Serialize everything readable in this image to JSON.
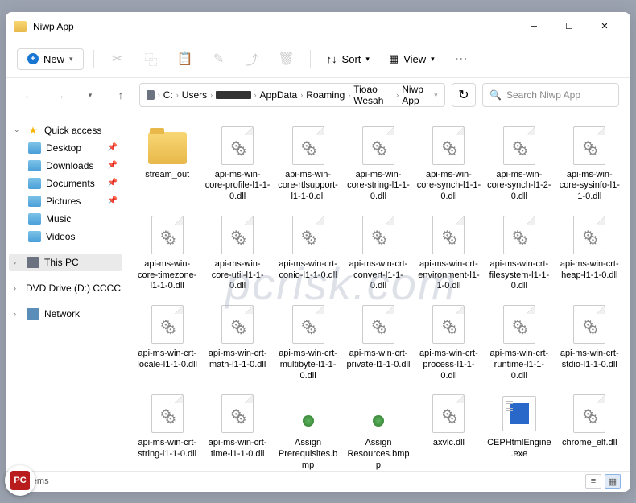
{
  "window": {
    "title": "Niwp App"
  },
  "toolbar": {
    "new_label": "New",
    "sort_label": "Sort",
    "view_label": "View"
  },
  "path": {
    "segments": [
      "C:",
      "Users",
      "[REDACTED]",
      "AppData",
      "Roaming",
      "Tioao Wesah",
      "Niwp App"
    ]
  },
  "search": {
    "placeholder": "Search Niwp App"
  },
  "sidebar": {
    "quick_access": "Quick access",
    "items": [
      {
        "label": "Desktop"
      },
      {
        "label": "Downloads"
      },
      {
        "label": "Documents"
      },
      {
        "label": "Pictures"
      },
      {
        "label": "Music"
      },
      {
        "label": "Videos"
      }
    ],
    "this_pc": "This PC",
    "dvd": "DVD Drive (D:) CCCC",
    "network": "Network"
  },
  "files": [
    {
      "name": "stream_out",
      "type": "folder"
    },
    {
      "name": "api-ms-win-core-profile-l1-1-0.dll",
      "type": "dll"
    },
    {
      "name": "api-ms-win-core-rtlsupport-l1-1-0.dll",
      "type": "dll"
    },
    {
      "name": "api-ms-win-core-string-l1-1-0.dll",
      "type": "dll"
    },
    {
      "name": "api-ms-win-core-synch-l1-1-0.dll",
      "type": "dll"
    },
    {
      "name": "api-ms-win-core-synch-l1-2-0.dll",
      "type": "dll"
    },
    {
      "name": "api-ms-win-core-sysinfo-l1-1-0.dll",
      "type": "dll"
    },
    {
      "name": "api-ms-win-core-timezone-l1-1-0.dll",
      "type": "dll"
    },
    {
      "name": "api-ms-win-core-util-l1-1-0.dll",
      "type": "dll"
    },
    {
      "name": "api-ms-win-crt-conio-l1-1-0.dll",
      "type": "dll"
    },
    {
      "name": "api-ms-win-crt-convert-l1-1-0.dll",
      "type": "dll"
    },
    {
      "name": "api-ms-win-crt-environment-l1-1-0.dll",
      "type": "dll"
    },
    {
      "name": "api-ms-win-crt-filesystem-l1-1-0.dll",
      "type": "dll"
    },
    {
      "name": "api-ms-win-crt-heap-l1-1-0.dll",
      "type": "dll"
    },
    {
      "name": "api-ms-win-crt-locale-l1-1-0.dll",
      "type": "dll"
    },
    {
      "name": "api-ms-win-crt-math-l1-1-0.dll",
      "type": "dll"
    },
    {
      "name": "api-ms-win-crt-multibyte-l1-1-0.dll",
      "type": "dll"
    },
    {
      "name": "api-ms-win-crt-private-l1-1-0.dll",
      "type": "dll"
    },
    {
      "name": "api-ms-win-crt-process-l1-1-0.dll",
      "type": "dll"
    },
    {
      "name": "api-ms-win-crt-runtime-l1-1-0.dll",
      "type": "dll"
    },
    {
      "name": "api-ms-win-crt-stdio-l1-1-0.dll",
      "type": "dll"
    },
    {
      "name": "api-ms-win-crt-string-l1-1-0.dll",
      "type": "dll"
    },
    {
      "name": "api-ms-win-crt-time-l1-1-0.dll",
      "type": "dll"
    },
    {
      "name": "Assign Prerequisites.bmp",
      "type": "bmp"
    },
    {
      "name": "Assign Resources.bmpp",
      "type": "bmp"
    },
    {
      "name": "axvlc.dll",
      "type": "dll"
    },
    {
      "name": "CEPHtmlEngine.exe",
      "type": "exe"
    },
    {
      "name": "chrome_elf.dll",
      "type": "dll"
    }
  ],
  "status": {
    "item_count": "90 items"
  },
  "watermark": "pcrisk.com"
}
